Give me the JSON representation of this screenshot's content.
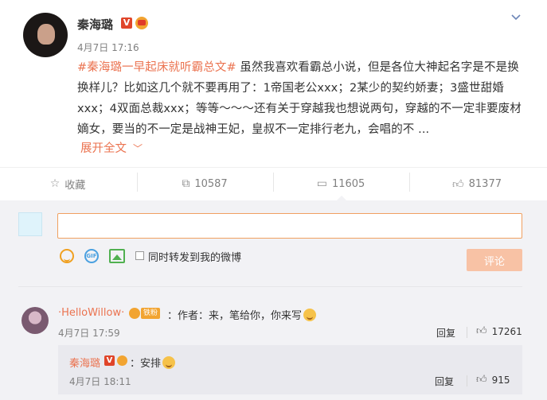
{
  "post": {
    "author": "秦海璐",
    "time": "4月7日 17:16",
    "topic": "#秦海璐一早起床就听霸总文#",
    "text": " 虽然我喜欢看霸总小说，但是各位大神起名字是不是换换样儿？比如这几个就不要再用了：1帝国老公xxx；2某少的契约娇妻；3盛世甜婚xxx；4双面总裁xxx；等等～～～还有关于穿越我也想说两句，穿越的不一定非要废材嫡女，要当的不一定是战神王妃，皇叔不一定排行老九，会唱的不 ...",
    "expand_label": "展开全文",
    "badge_v": "V"
  },
  "actions": {
    "favorite": {
      "label": "收藏",
      "icon": "star-outline-icon"
    },
    "forward": {
      "label": "10587",
      "icon": "share-icon"
    },
    "comment": {
      "label": "11605",
      "icon": "comment-icon"
    },
    "like": {
      "label": "81377",
      "icon": "thumbs-up-icon"
    }
  },
  "composer": {
    "input_value": "",
    "checkbox_label": "同时转发到我的微博",
    "submit_label": "评论",
    "gif_label": "GIF"
  },
  "comments": [
    {
      "author": "·HelloWillow·",
      "fan_badge": "铁粉",
      "text": "：作者：来，笔给你，你来写",
      "time": "4月7日 17:59",
      "reply_label": "回复",
      "likes": "17261",
      "reply": {
        "author": "秦海璐",
        "badge_v": "V",
        "text": "：安排",
        "time": "4月7日 18:11",
        "reply_label": "回复",
        "likes": "915"
      }
    }
  ],
  "colors": {
    "accent": "#eb7350",
    "submit_bg": "#f8c2a5",
    "panel_bg": "#f2f2f5"
  }
}
